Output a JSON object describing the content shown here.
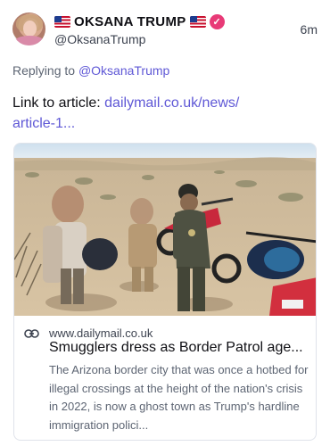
{
  "author": {
    "display_name": "OKSANA TRUMP",
    "handle": "@OksanaTrump",
    "time_ago": "6m",
    "avatar": "profile-photo",
    "flag_icon": "us-flag-icon",
    "verified_icon": "verified-check-icon",
    "verified_color": "#e83a77"
  },
  "reply": {
    "prefix": "Replying to",
    "mention": "@OksanaTrump"
  },
  "post": {
    "text_prefix": "Link to article: ",
    "link_line1": "dailymail.co.uk/news/",
    "link_line2": "article-1..."
  },
  "link_card": {
    "domain": "www.dailymail.co.uk",
    "title": "Smugglers dress as Border Patrol age...",
    "description": "The Arizona border city that was once a hotbed for illegal crossings at the height of the nation's crisis in 2022, is now a ghost town as Trump's hardline immigration polici...",
    "image": "desert-border-scene-photo",
    "link_icon": "link-chain-icon"
  },
  "colors": {
    "accent": "#5f58d6",
    "text": "#0f0f14",
    "muted": "#5d6573"
  }
}
